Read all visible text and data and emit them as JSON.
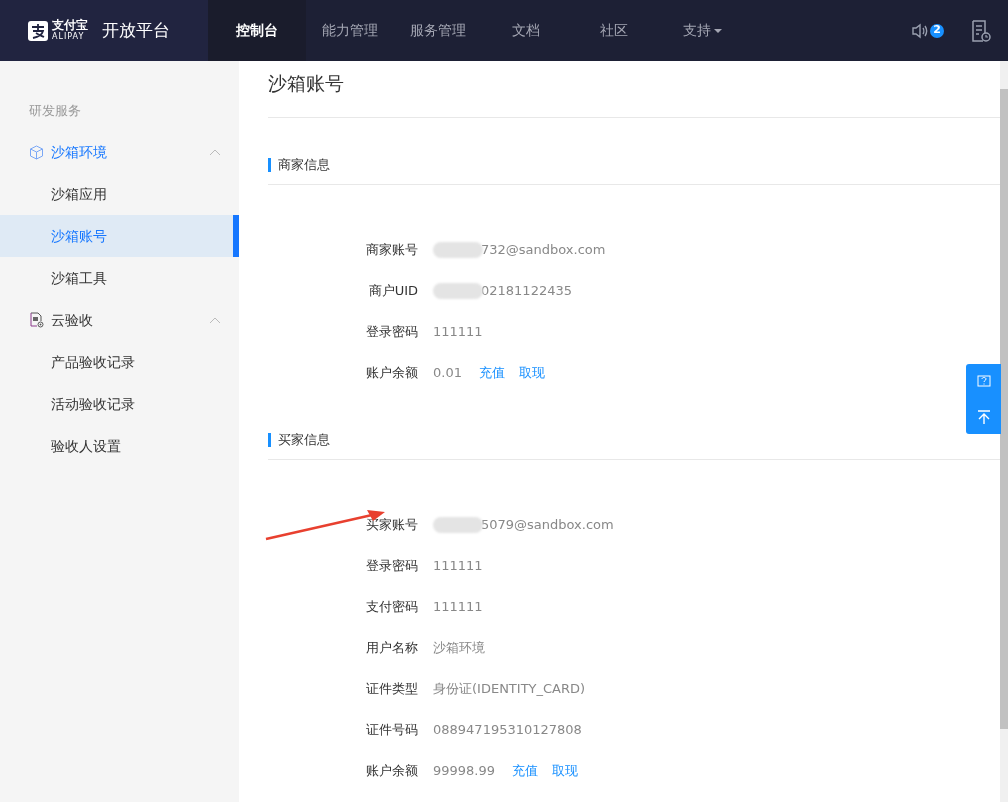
{
  "header": {
    "logo_cn": "支付宝",
    "logo_en": "ALIPAY",
    "product": "开放平台",
    "nav": [
      {
        "label": "控制台",
        "selected": true,
        "dropdown": false
      },
      {
        "label": "能力管理",
        "selected": false,
        "dropdown": false
      },
      {
        "label": "服务管理",
        "selected": false,
        "dropdown": false
      },
      {
        "label": "文档",
        "selected": false,
        "dropdown": false
      },
      {
        "label": "社区",
        "selected": false,
        "dropdown": false
      },
      {
        "label": "支持",
        "selected": false,
        "dropdown": true
      }
    ],
    "notification_count": "2"
  },
  "sidebar": {
    "heading": "研发服务",
    "groups": [
      {
        "label": "沙箱环境",
        "expanded": true,
        "children": [
          {
            "label": "沙箱应用",
            "selected": false
          },
          {
            "label": "沙箱账号",
            "selected": true
          },
          {
            "label": "沙箱工具",
            "selected": false
          }
        ]
      },
      {
        "label": "云验收",
        "expanded": true,
        "children": [
          {
            "label": "产品验收记录",
            "selected": false
          },
          {
            "label": "活动验收记录",
            "selected": false
          },
          {
            "label": "验收人设置",
            "selected": false
          }
        ]
      }
    ]
  },
  "page_title": "沙箱账号",
  "sections": [
    {
      "title": "商家信息",
      "rows": [
        {
          "label": "商家账号",
          "value": "732@sandbox.com",
          "redacted": true
        },
        {
          "label": "商户UID",
          "value": "02181122435",
          "redacted": true
        },
        {
          "label": "登录密码",
          "value": "111111",
          "redacted": false
        },
        {
          "label": "账户余额",
          "value": "0.01",
          "redacted": false,
          "links": [
            "充值",
            "取现"
          ]
        }
      ]
    },
    {
      "title": "买家信息",
      "rows": [
        {
          "label": "买家账号",
          "value": "5079@sandbox.com",
          "redacted": true
        },
        {
          "label": "登录密码",
          "value": "111111",
          "redacted": false
        },
        {
          "label": "支付密码",
          "value": "111111",
          "redacted": false
        },
        {
          "label": "用户名称",
          "value": "沙箱环境",
          "redacted": false
        },
        {
          "label": "证件类型",
          "value": "身份证(IDENTITY_CARD)",
          "redacted": false
        },
        {
          "label": "证件号码",
          "value": "088947195310127808",
          "redacted": false
        },
        {
          "label": "账户余额",
          "value": "99998.99",
          "redacted": false,
          "links": [
            "充值",
            "取现"
          ]
        }
      ]
    }
  ]
}
